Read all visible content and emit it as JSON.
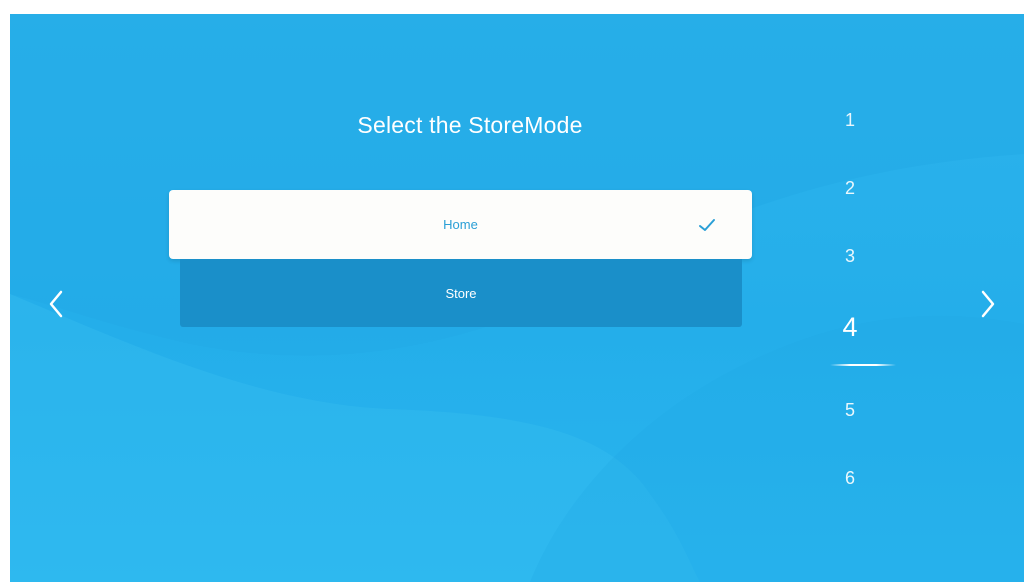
{
  "screen": {
    "title": "Select the StoreMode"
  },
  "options": [
    {
      "label": "Home",
      "selected": true
    },
    {
      "label": "Store",
      "selected": false
    }
  ],
  "navigation": {
    "prev_icon": "chevron-left-icon",
    "next_icon": "chevron-right-icon"
  },
  "steps": {
    "items": [
      "1",
      "2",
      "3",
      "4",
      "5",
      "6"
    ],
    "current": "4"
  },
  "colors": {
    "background": "#29b2ec",
    "selected_bg": "#fdfdfb",
    "selected_text": "#2a9fd6",
    "unselected_bg": "#1a8fc9",
    "text": "#ffffff"
  }
}
